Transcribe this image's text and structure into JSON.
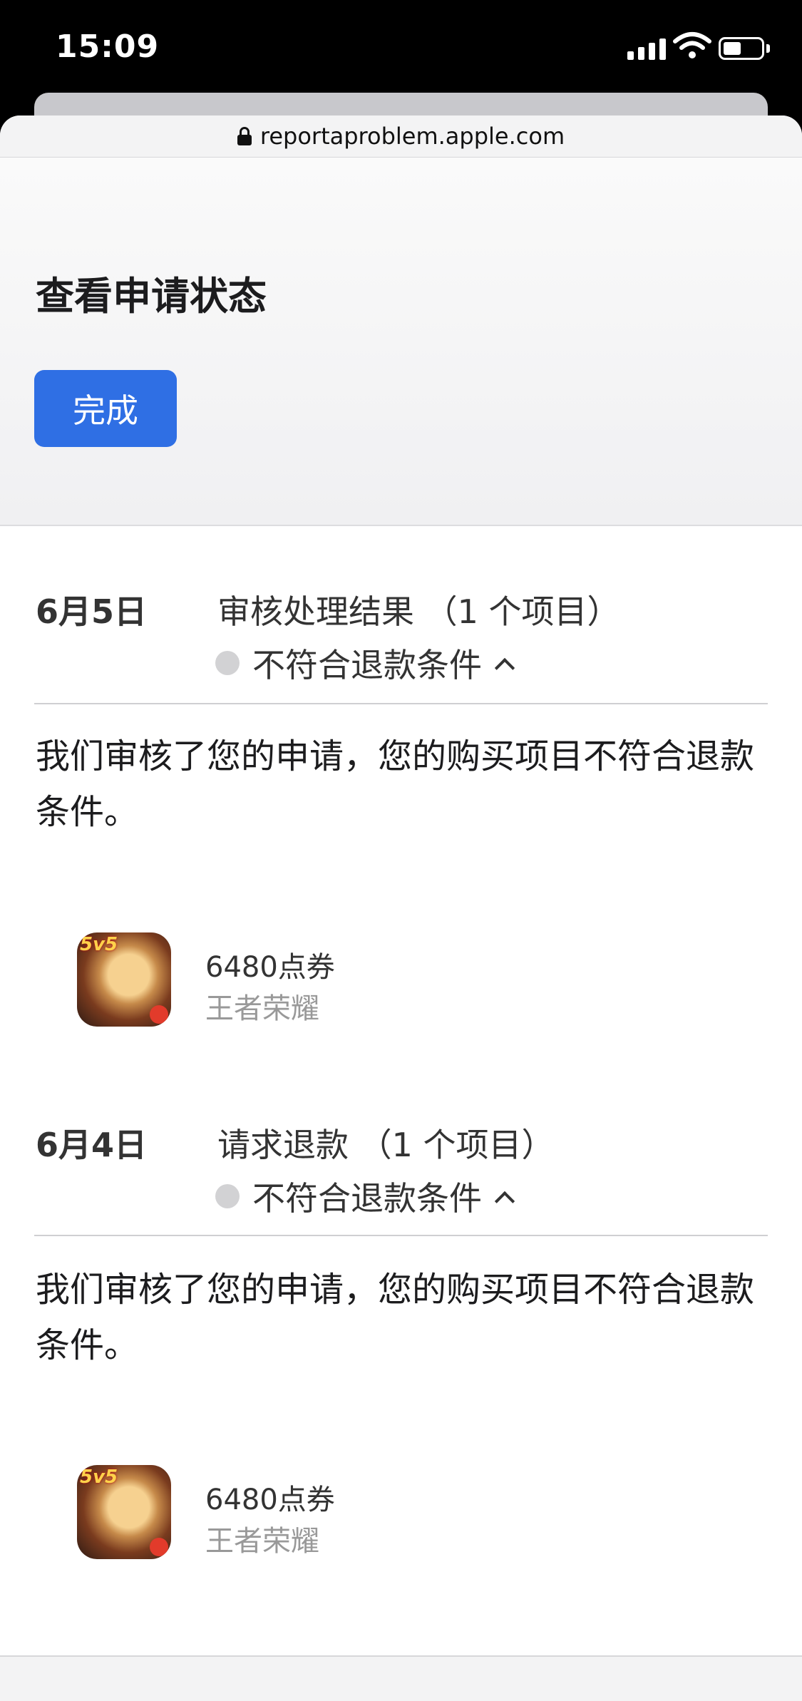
{
  "status_bar": {
    "time": "15:09"
  },
  "browser": {
    "url": "reportaproblem.apple.com"
  },
  "header": {
    "title": "查看申请状态",
    "done_label": "完成"
  },
  "entries": [
    {
      "date": "6月5日",
      "title": "审核处理结果 （1 个项目）",
      "status": "不符合退款条件",
      "message": "我们审核了您的申请，您的购买项目不符合退款条件。",
      "item": {
        "name": "6480点券",
        "app": "王者荣耀",
        "icon_badge": "5v5"
      }
    },
    {
      "date": "6月4日",
      "title": "请求退款 （1 个项目）",
      "status": "不符合退款条件",
      "message": "我们审核了您的申请，您的购买项目不符合退款条件。",
      "item": {
        "name": "6480点券",
        "app": "王者荣耀",
        "icon_badge": "5v5"
      }
    }
  ],
  "colors": {
    "accent": "#2f6fe4",
    "status_dot": "#d2d2d4"
  },
  "icons": [
    "lock-icon",
    "chevron-up-icon",
    "wifi-icon",
    "battery-icon",
    "signal-icon"
  ]
}
